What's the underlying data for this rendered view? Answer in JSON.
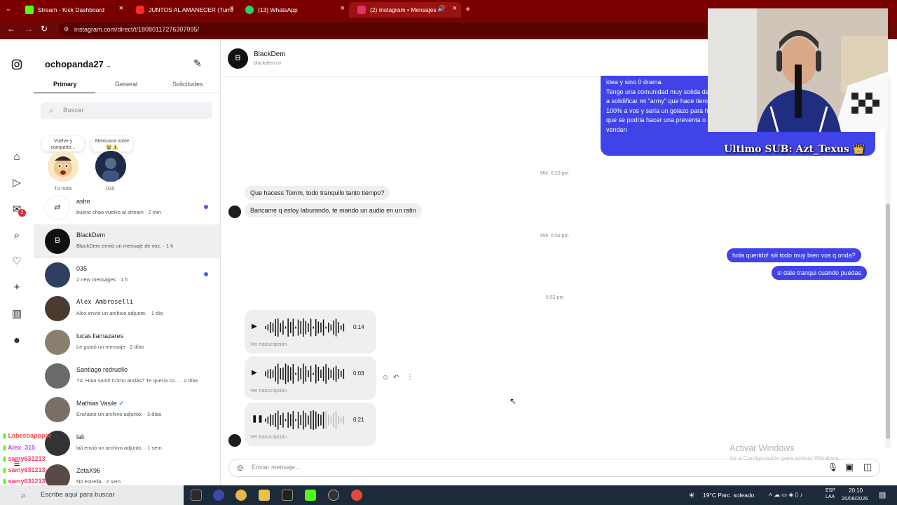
{
  "browser": {
    "tabs": [
      {
        "label": "Stream - Kick Dashboard",
        "icon": "kick-icon",
        "color": "#53fc18"
      },
      {
        "label": "JUNTOS AL AMANECER (Turre",
        "icon": "youtube-icon",
        "color": "#ff2a2a"
      },
      {
        "label": "(13) WhatsApp",
        "icon": "whatsapp-icon",
        "color": "#25d366"
      },
      {
        "label": "(2) Instagram • Mensajes",
        "icon": "instagram-icon",
        "color": "#e1306c"
      }
    ],
    "url": "instagram.com/direct/t/18080117276307095/"
  },
  "sidebar": {
    "badges": {
      "messages": "2"
    }
  },
  "inbox": {
    "username": "ochopanda27",
    "tabs": [
      "Primary",
      "General",
      "Solicitudes"
    ],
    "search_placeholder": "Buscar",
    "notes": [
      {
        "bubble": "Vuelve y comparte...",
        "label": "Tu nota"
      },
      {
        "bubble": "Mexicana volve 😭⚠️",
        "label": "035"
      }
    ],
    "conversations": [
      {
        "name": "asho",
        "sub": "bueno chao vuelvo al stream · 2 min",
        "unread": true
      },
      {
        "name": "BlackDem",
        "sub": "BlackDem envió un mensaje de voz. · 1 h",
        "unread": false
      },
      {
        "name": "035",
        "sub": "2 new messages · 1 h",
        "unread": true
      },
      {
        "name": "Alex Ambroselli",
        "sub": "Alex envió un archivo adjunto. · 1 día",
        "unread": false
      },
      {
        "name": "lucas llamazares",
        "sub": "Le gustó un mensaje · 2 días",
        "unread": false
      },
      {
        "name": "Santiago redruello",
        "sub": "Tú: Hola santi! Cómo andás? Te quería co... · 2 días",
        "unread": false
      },
      {
        "name": "Mathias Vasile",
        "sub": "Enviaste un archivo adjunto. · 3 días",
        "unread": false
      },
      {
        "name": "lali",
        "sub": "lali envió un archivo adjunto. · 1 sem",
        "unread": false
      },
      {
        "name": "ZetaX96",
        "sub": "No estrella · 2 sem",
        "unread": false
      }
    ]
  },
  "chat": {
    "name": "BlackDem",
    "handle": "blackdem.co",
    "sent_block": "idea y sino 0 drama.\nTengo una comunidad muy solida de unos 60 pibitos mas que van y vienen, y quiero empezar a solidificar mi \"army\" que hace tiempo reme que diga pandas team y por eso me quedaria 100% a vos y seria un golazo para hacerlo y promover tu marca pensaba! (Tambien pense que se podria hacer una preventa o algo asi para no hacer una tirada y claramente no se vendan",
    "time1": "Mié, 6:23 pm",
    "in1": "Que hacess Tomm, todo tranquilo tanto tiempo?",
    "in2": "Bancame q estoy laburando, te mando un audio en un ratin",
    "time2": "Mié, 6:59 pm",
    "out1": "hola querido! siii todo muy bien vos q onda?",
    "out2": "si dale tranqui cuando puedas",
    "time3": "6:52 pm",
    "voice_messages": [
      {
        "duration": "0:14",
        "state": "play",
        "transcript": "Ver transcripción"
      },
      {
        "duration": "0:03",
        "state": "play",
        "transcript": "Ver transcripción"
      },
      {
        "duration": "0:21",
        "state": "pause",
        "transcript": "Ver transcripción",
        "progress": 0.75
      }
    ],
    "composer_placeholder": "Enviar mensaje..."
  },
  "overlay": {
    "sub_text": "Ultimo SUB: Azt_Texus 👑",
    "activate_title": "Activar Windows",
    "activate_sub": "Ve a Configuración para activar Windows.",
    "chat_lines": [
      {
        "user": "Labestiapopor",
        "color": "#ff4d4d"
      },
      {
        "user": "Alex_315",
        "color": "#b04dff"
      },
      {
        "user": "samy631213",
        "color": "#ff3b6b"
      },
      {
        "user": "samy631213",
        "color": "#ff3b6b"
      },
      {
        "user": "samy631213",
        "color": "#ff3b6b"
      }
    ]
  },
  "taskbar": {
    "search": "Escribe aquí para buscar",
    "weather": "19°C  Parc. soleado",
    "lang": "ESP\nLAA",
    "time": "20:10",
    "date": "20/08/2026"
  }
}
